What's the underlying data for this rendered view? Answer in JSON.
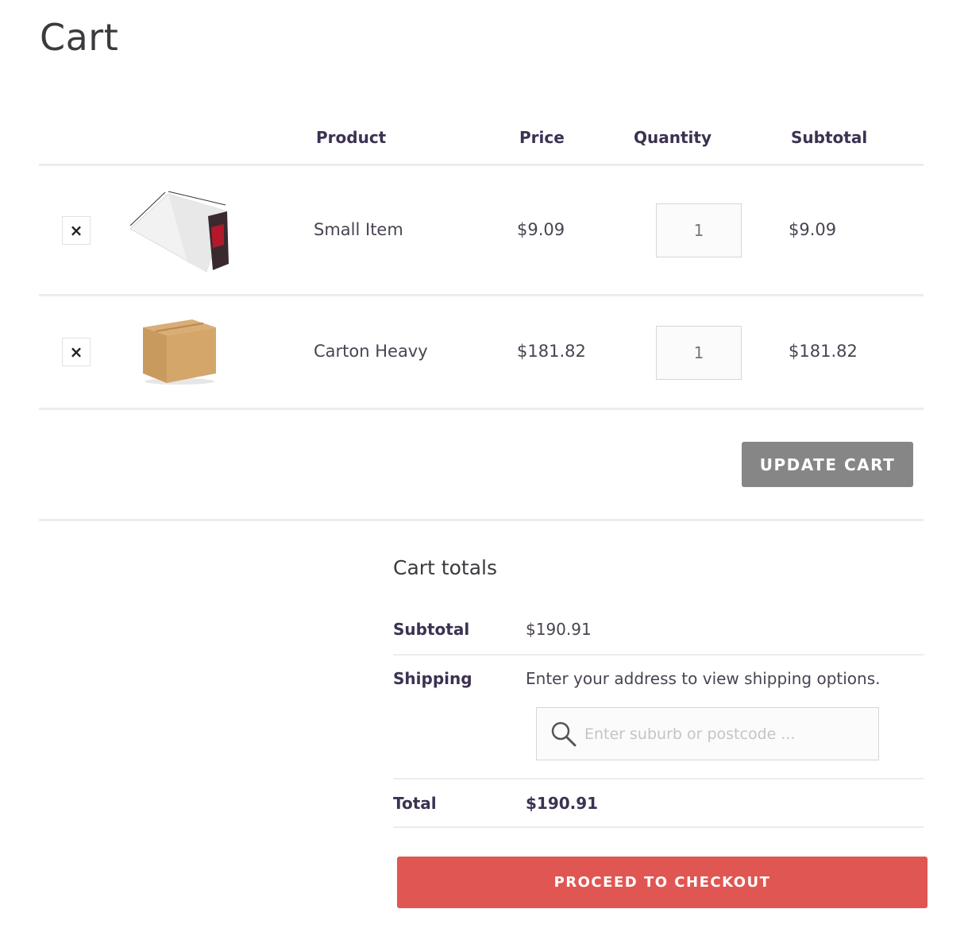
{
  "page": {
    "title": "Cart"
  },
  "table": {
    "headers": {
      "product": "Product",
      "price": "Price",
      "quantity": "Quantity",
      "subtotal": "Subtotal"
    },
    "remove_glyph": "×",
    "items": [
      {
        "name": "Small Item",
        "price": "$9.09",
        "quantity": "1",
        "subtotal": "$9.09",
        "thumb_icon": "satchel-bag-icon"
      },
      {
        "name": "Carton Heavy",
        "price": "$181.82",
        "quantity": "1",
        "subtotal": "$181.82",
        "thumb_icon": "cardboard-box-icon"
      }
    ]
  },
  "actions": {
    "update_cart": "UPDATE CART"
  },
  "totals": {
    "title": "Cart totals",
    "subtotal_label": "Subtotal",
    "subtotal_value": "$190.91",
    "shipping_label": "Shipping",
    "shipping_text": "Enter your address to view shipping options.",
    "shipping_placeholder": "Enter suburb or postcode ...",
    "total_label": "Total",
    "total_value": "$190.91",
    "checkout": "PROCEED TO CHECKOUT"
  },
  "colors": {
    "checkout": "#e05652",
    "update": "#868686",
    "heading": "#3c3251"
  }
}
